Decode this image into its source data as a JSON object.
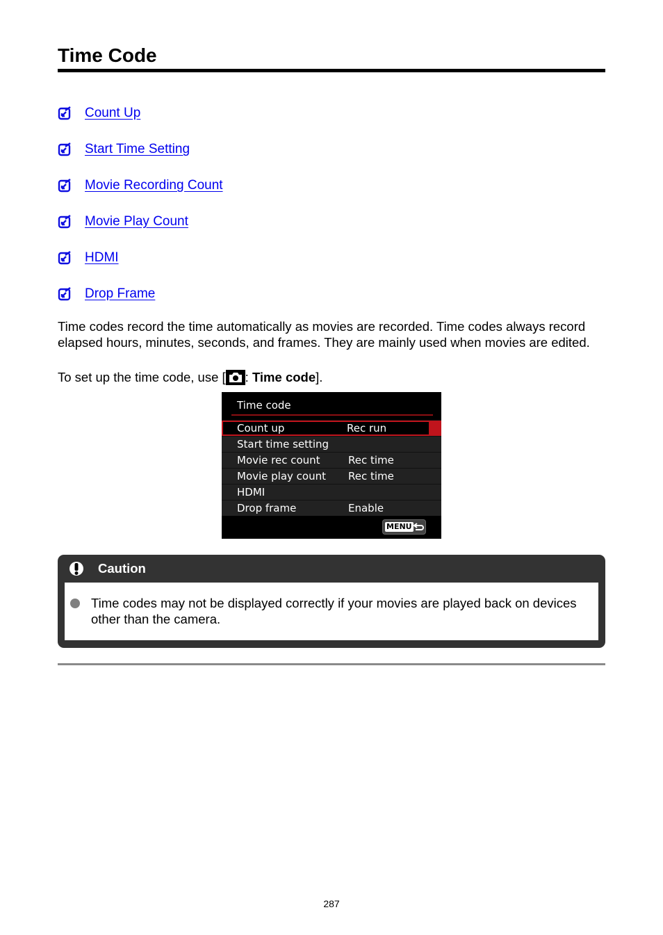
{
  "page": {
    "title": "Time Code",
    "page_number": "287"
  },
  "toc": {
    "icon": "checkbox-arrow-icon",
    "link_color": "#0000ee",
    "items": [
      {
        "label": "Count Up"
      },
      {
        "label": "Start Time Setting"
      },
      {
        "label": "Movie Recording Count"
      },
      {
        "label": "Movie Play Count"
      },
      {
        "label": "HDMI"
      },
      {
        "label": "Drop Frame"
      }
    ]
  },
  "intro": {
    "paragraph": "Time codes record the time automatically as movies are recorded. Time codes always record elapsed hours, minutes, seconds, and frames. They are mainly used when movies are edited.",
    "setup_prefix": "To set up the time code, use [",
    "setup_icon": "camera-icon",
    "setup_sep": ": ",
    "setup_menu": "Time code",
    "setup_suffix": "]."
  },
  "camera_screen": {
    "title": "Time code",
    "accent_color": "#c0141c",
    "rows": [
      {
        "label": "Count up",
        "value": "Rec run",
        "selected": true
      },
      {
        "label": "Start time setting",
        "value": ""
      },
      {
        "label": "Movie rec count",
        "value": "Rec time"
      },
      {
        "label": "Movie play count",
        "value": "Rec time"
      },
      {
        "label": "HDMI",
        "value": ""
      },
      {
        "label": "Drop frame",
        "value": "Enable"
      }
    ],
    "menu_button": "MENU",
    "menu_icon": "return-arrow-icon"
  },
  "caution": {
    "icon": "exclamation-icon",
    "title": "Caution",
    "items": [
      {
        "text": "Time codes may not be displayed correctly if your movies are played back on devices other than the camera."
      }
    ]
  }
}
